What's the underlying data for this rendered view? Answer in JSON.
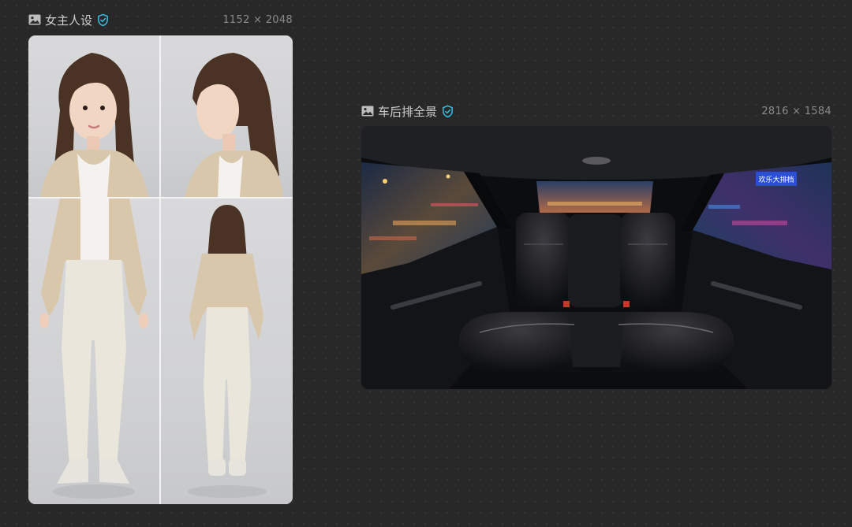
{
  "canvas": {
    "cards": [
      {
        "title": "女主人设",
        "dimensions": "1152 × 2048",
        "icon": "image-icon",
        "badge_icon": "verified-shield-icon",
        "image": "character-reference-sheet"
      },
      {
        "title": "车后排全景",
        "dimensions": "2816 × 1584",
        "icon": "image-icon",
        "badge_icon": "verified-shield-icon",
        "image": "car-rear-seat-panorama"
      }
    ],
    "car_image": {
      "neon_sign": "欢乐大排档"
    }
  },
  "colors": {
    "background": "#282828",
    "title_text": "#cfcfcf",
    "dimension_text": "#8a8a8a",
    "verified_badge": "#33c2e6"
  }
}
